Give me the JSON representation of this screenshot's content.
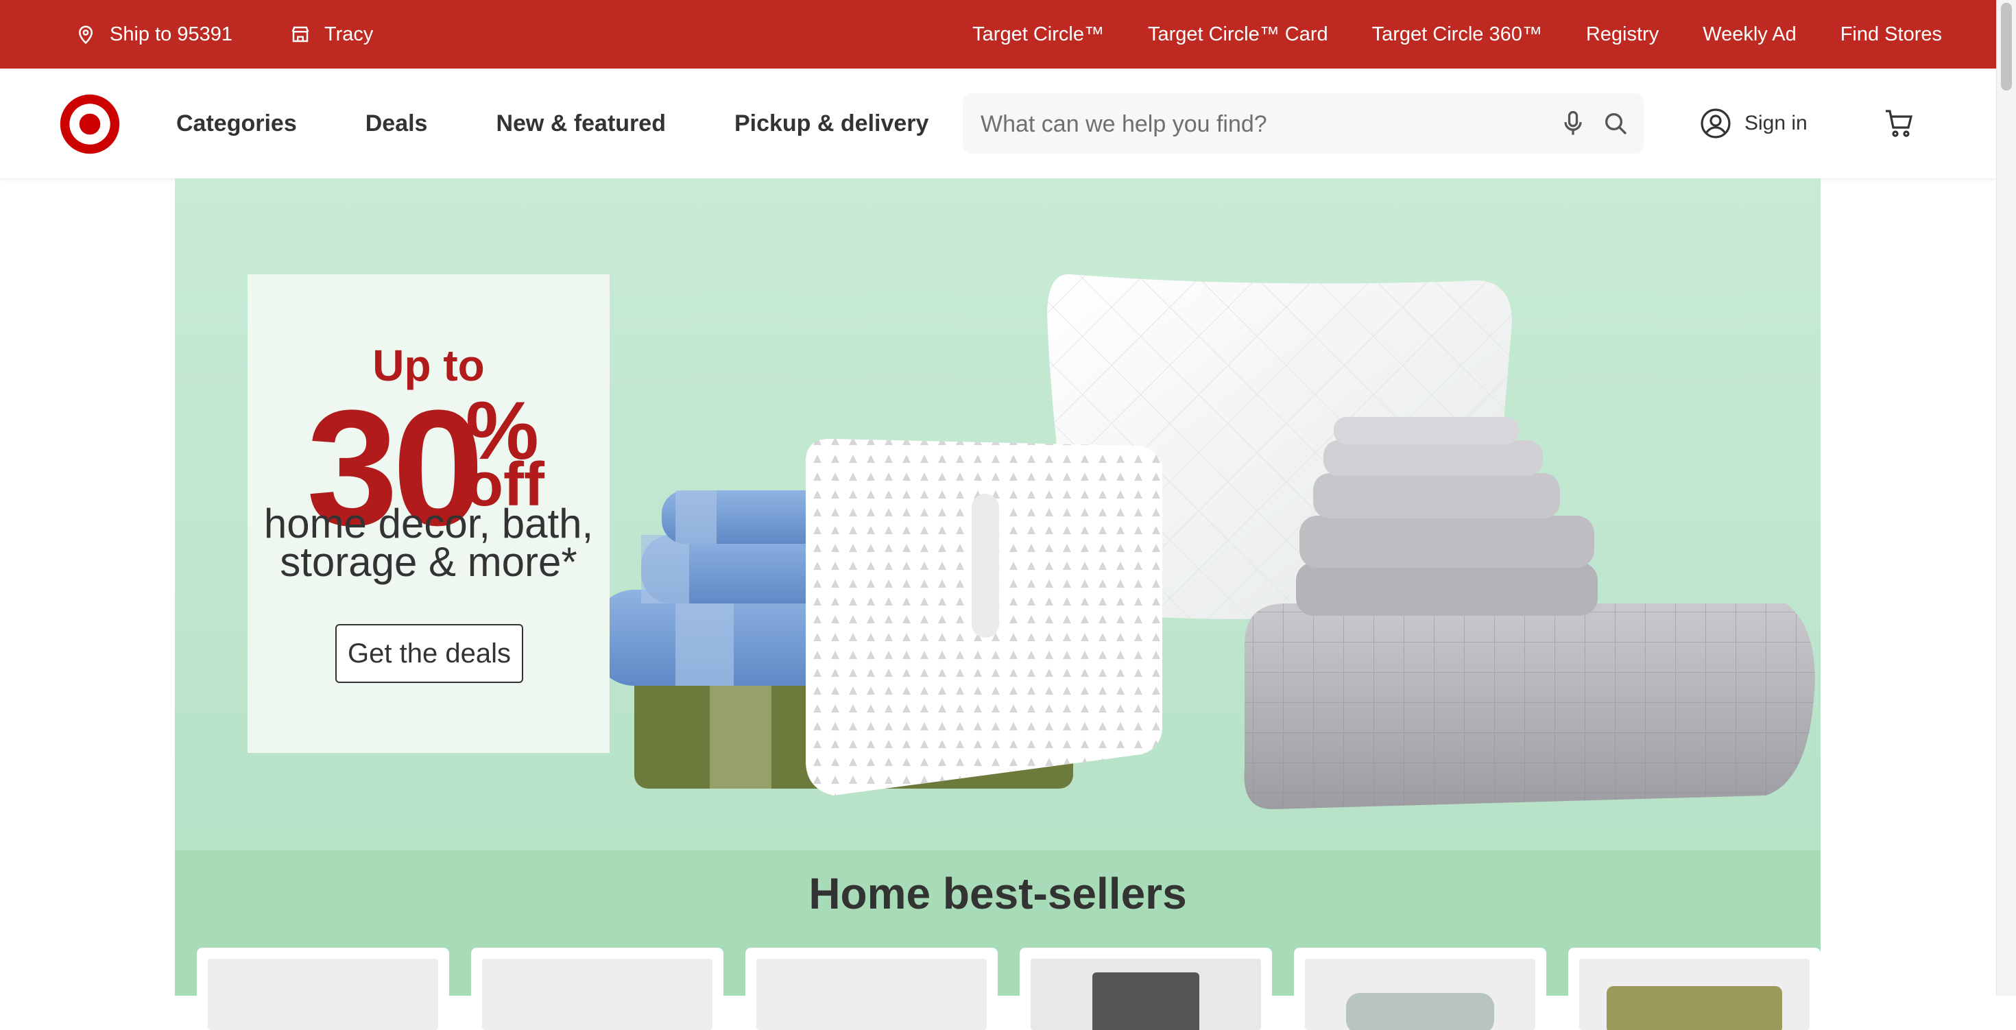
{
  "utility_bar": {
    "ship_to": "Ship to 95391",
    "store": "Tracy",
    "links": [
      "Target Circle™",
      "Target Circle™ Card",
      "Target Circle 360™",
      "Registry",
      "Weekly Ad",
      "Find Stores"
    ]
  },
  "header": {
    "nav": [
      "Categories",
      "Deals",
      "New & featured",
      "Pickup & delivery"
    ],
    "search_placeholder": "What can we help you find?",
    "sign_in": "Sign in"
  },
  "hero": {
    "up_to": "Up to",
    "big_number": "30",
    "percent": "%",
    "off": "off",
    "desc_line1": "home decor, bath,",
    "desc_line2": "storage & more*",
    "cta": "Get the deals"
  },
  "bestsellers": {
    "title": "Home best-sellers"
  },
  "colors": {
    "brand_red": "#be2a21",
    "hero_green": "#c8ebd6",
    "section_green": "#a8dbb7",
    "promo_red": "#b11b1b"
  },
  "icons": [
    "location-pin-icon",
    "store-icon",
    "target-logo",
    "microphone-icon",
    "search-icon",
    "account-icon",
    "cart-icon"
  ]
}
